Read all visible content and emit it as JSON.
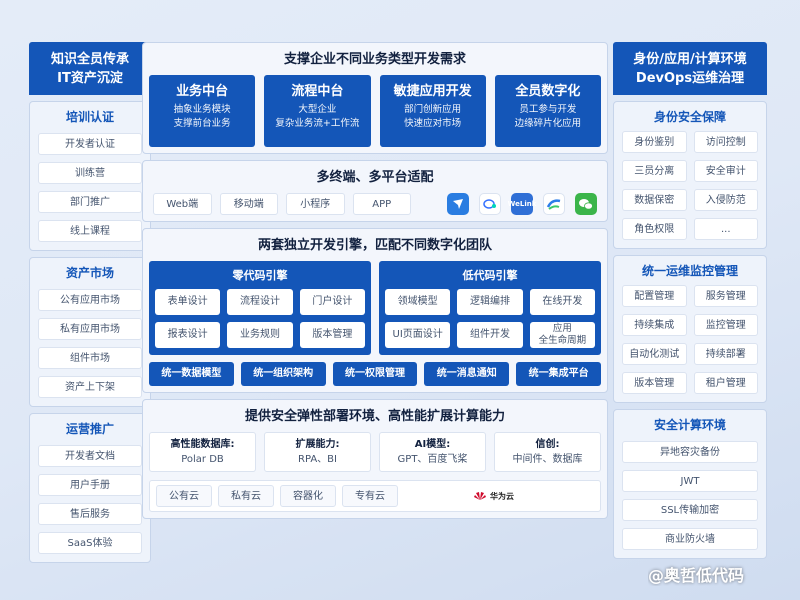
{
  "left": {
    "header": [
      "知识全员传承",
      "IT资产沉淀"
    ],
    "panels": [
      {
        "title": "培训认证",
        "items": [
          "开发者认证",
          "训练营",
          "部门推广",
          "线上课程"
        ]
      },
      {
        "title": "资产市场",
        "items": [
          "公有应用市场",
          "私有应用市场",
          "组件市场",
          "资产上下架"
        ]
      },
      {
        "title": "运营推广",
        "items": [
          "开发者文档",
          "用户手册",
          "售后服务",
          "SaaS体验"
        ]
      }
    ]
  },
  "right": {
    "header": [
      "身份/应用/计算环境",
      "DevOps运维治理"
    ],
    "panels": [
      {
        "title": "身份安全保障",
        "items": [
          "身份鉴别",
          "访问控制",
          "三员分离",
          "安全审计",
          "数据保密",
          "入侵防范",
          "角色权限",
          "..."
        ]
      },
      {
        "title": "统一运维监控管理",
        "items": [
          "配置管理",
          "服务管理",
          "持续集成",
          "监控管理",
          "自动化测试",
          "持续部署",
          "版本管理",
          "租户管理"
        ]
      },
      {
        "title": "安全计算环境",
        "items": [
          "异地容灾备份",
          "JWT",
          "SSL传输加密",
          "商业防火墙"
        ]
      }
    ]
  },
  "center": {
    "business": {
      "title": "支撑企业不同业务类型开发需求",
      "cards": [
        {
          "title": "业务中台",
          "lines": [
            "抽象业务模块",
            "支撑前台业务"
          ]
        },
        {
          "title": "流程中台",
          "lines": [
            "大型企业",
            "复杂业务流+工作流"
          ]
        },
        {
          "title": "敏捷应用开发",
          "lines": [
            "部门创新应用",
            "快速应对市场"
          ]
        },
        {
          "title": "全员数字化",
          "lines": [
            "员工参与开发",
            "边缘碎片化应用"
          ]
        }
      ]
    },
    "terminals": {
      "title": "多终端、多平台适配",
      "items": [
        "Web端",
        "移动端",
        "小程序",
        "APP"
      ],
      "apps": [
        {
          "name": "dingtalk-icon",
          "color": "#2a7de1",
          "label": ""
        },
        {
          "name": "feishu-icon",
          "color": "#ffffff",
          "label": ""
        },
        {
          "name": "welink-icon",
          "color": "#2f6fd6",
          "label": "WeLink"
        },
        {
          "name": "wecom-icon",
          "color": "#ffffff",
          "label": ""
        },
        {
          "name": "wechat-icon",
          "color": "#3bb54a",
          "label": ""
        }
      ]
    },
    "engines": {
      "title": "两套独立开发引擎，匹配不同数字化团队",
      "zero": {
        "title": "零代码引擎",
        "items": [
          "表单设计",
          "流程设计",
          "门户设计",
          "报表设计",
          "业务规则",
          "版本管理"
        ]
      },
      "low": {
        "title": "低代码引擎",
        "items": [
          "领域模型",
          "逻辑编排",
          "在线开发",
          "UI页面设计",
          "组件开发",
          "应用\n全生命周期"
        ]
      },
      "unified": [
        "统一数据模型",
        "统一组织架构",
        "统一权限管理",
        "统一消息通知",
        "统一集成平台"
      ]
    },
    "infra": {
      "title": "提供安全弹性部署环境、高性能扩展计算能力",
      "caps": [
        {
          "k": "高性能数据库:",
          "v": "Polar DB"
        },
        {
          "k": "扩展能力:",
          "v": "RPA、BI"
        },
        {
          "k": "AI模型:",
          "v": "GPT、百度飞桨"
        },
        {
          "k": "信创:",
          "v": "中间件、数据库"
        }
      ],
      "clouds": [
        "公有云",
        "私有云",
        "容器化",
        "专有云"
      ],
      "vendor": "华为云"
    }
  },
  "watermark": "@奥哲低代码"
}
